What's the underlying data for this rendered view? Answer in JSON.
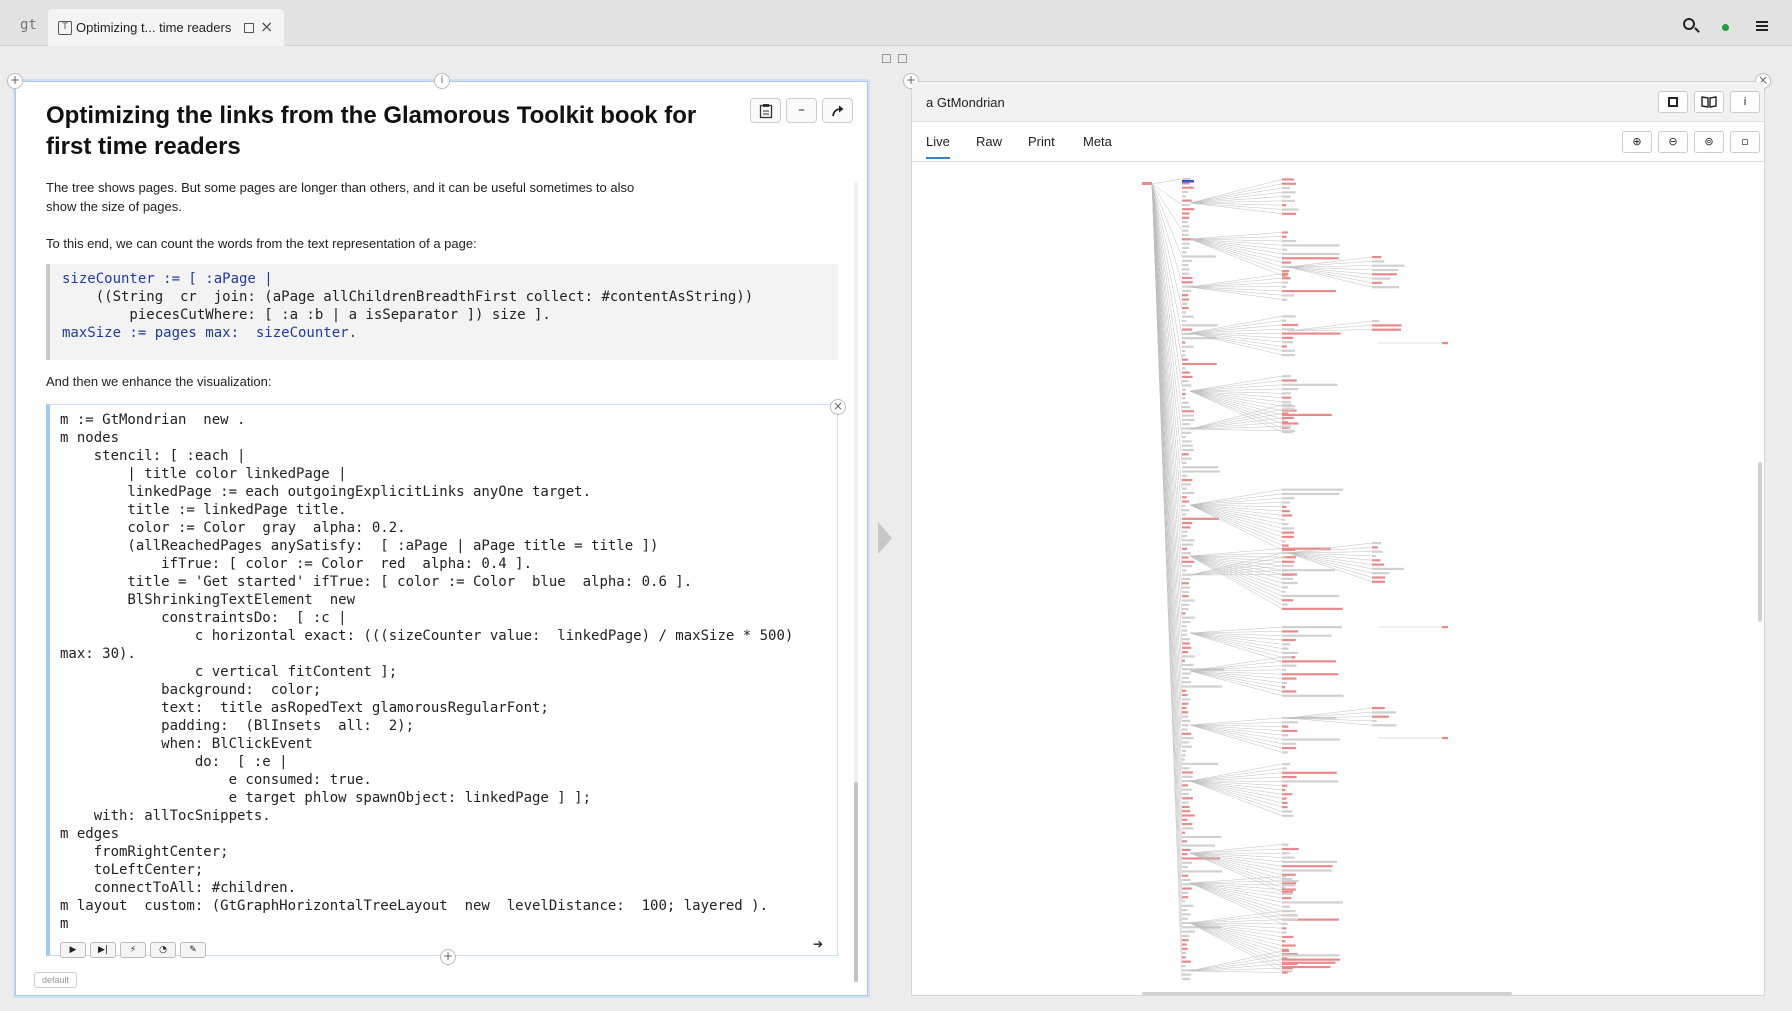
{
  "topbar": {
    "logo": "gt",
    "tab": {
      "icon": "T",
      "label": "Optimizing t... time readers"
    }
  },
  "left_pane": {
    "title": "Optimizing the links from the Glamorous Toolkit book for first time readers",
    "toolbar": {
      "copy_icon": "clipboard-icon",
      "collapse_label": "–",
      "open_icon": "arrow-icon"
    },
    "paragraphs": [
      "The tree shows pages. But some pages are longer than others, and it can be useful sometimes to also show the size of pages.",
      "To this end, we can count the words from the text representation of a page:",
      "And then we enhance the visualization:"
    ],
    "snippet1_lines": [
      "sizeCounter := [ :aPage |",
      "    ((String  cr  join: (aPage allChildrenBreadthFirst collect: #contentAsString))",
      "        piecesCutWhere: [ :a :b | a isSeparator ]) size ].",
      "maxSize := pages max:  sizeCounter."
    ],
    "snippet2_lines": [
      "m := GtMondrian  new .",
      "m nodes ",
      "    stencil: [ :each |",
      "        | title color linkedPage |",
      "        linkedPage := each outgoingExplicitLinks anyOne target.",
      "        title := linkedPage title.",
      "        color := Color  gray  alpha: 0.2.",
      "        (allReachedPages anySatisfy:  [ :aPage | aPage title = title ])",
      "            ifTrue: [ color := Color  red  alpha: 0.4 ].",
      "        title = 'Get started' ifTrue: [ color := Color  blue  alpha: 0.6 ].",
      "        BlShrinkingTextElement  new",
      "            constraintsDo:  [ :c |",
      "                c horizontal exact: (((sizeCounter value:  linkedPage) / maxSize * 500)",
      "max: 30).",
      "                c vertical fitContent ];",
      "            background:  color;",
      "            text:  title asRopedText glamorousRegularFont;",
      "            padding:  (BlInsets  all:  2);",
      "            when: BlClickEvent ",
      "                do:  [ :e |",
      "                    e consumed: true.",
      "                    e target phlow spawnObject: linkedPage ] ];",
      "    with: allTocSnippets.",
      "m edges ",
      "    fromRightCenter;",
      "    toLeftCenter;",
      "    connectToAll: #children.",
      "m layout  custom: (GtGraphHorizontalTreeLayout  new  levelDistance:  100; layered ).",
      "m"
    ],
    "editor_actions": [
      "▶",
      "▶|",
      "⚡",
      "◔",
      "✎"
    ],
    "default_tag": "default"
  },
  "right_pane": {
    "title": "a GtMondrian",
    "tabs": [
      "Live",
      "Raw",
      "Print",
      "Meta"
    ],
    "active_tab": "Live",
    "colors": {
      "red": "#e88a8a",
      "gray": "#d0d0d0",
      "blue": "#3a4fd8",
      "edge": "#bfbfbf"
    }
  }
}
